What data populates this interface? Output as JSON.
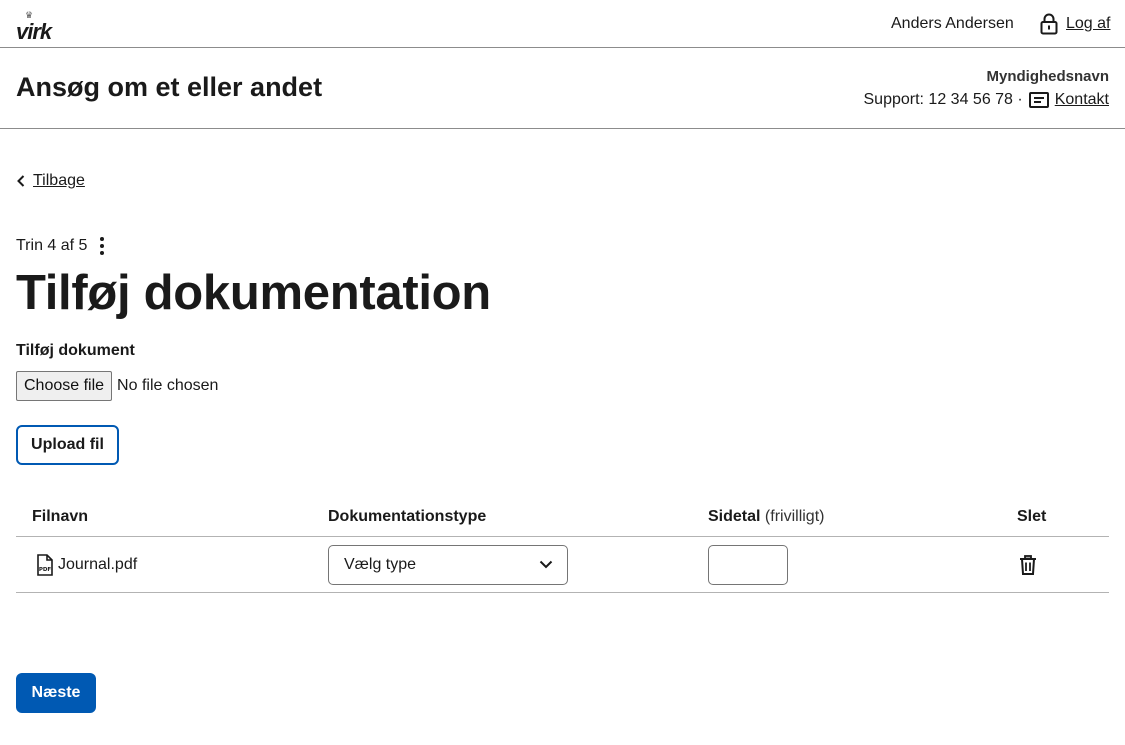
{
  "header": {
    "logo_text": "virk",
    "crown": "♛",
    "user_name": "Anders Andersen",
    "logout_label": "Log af"
  },
  "appbar": {
    "title": "Ansøg om et eller andet",
    "authority": "Myndighedsnavn",
    "support_text": "Support: 12 34 56 78 ·",
    "contact_label": "Kontakt"
  },
  "nav": {
    "back_label": "Tilbage"
  },
  "step": {
    "text": "Trin 4 af 5"
  },
  "page": {
    "title": "Tilføj dokumentation"
  },
  "upload": {
    "field_label": "Tilføj dokument",
    "choose_label": "Choose file",
    "no_file_text": "No file chosen",
    "upload_button": "Upload fil"
  },
  "table": {
    "headers": {
      "filename": "Filnavn",
      "doctype": "Dokumentationstype",
      "pages": "Sidetal",
      "pages_hint": "(frivilligt)",
      "delete": "Slet"
    },
    "rows": [
      {
        "filename": "Journal.pdf",
        "doctype_value": "Vælg type",
        "pages_value": ""
      }
    ]
  },
  "footer": {
    "next_button": "Næste"
  },
  "colors": {
    "primary": "#0059b3",
    "border": "#8c8c8c",
    "text": "#1a1a1a"
  },
  "icons": [
    "lock-icon",
    "contact-icon",
    "chevron-left-icon",
    "kebab-menu-icon",
    "pdf-file-icon",
    "chevron-down-icon",
    "trash-icon"
  ]
}
